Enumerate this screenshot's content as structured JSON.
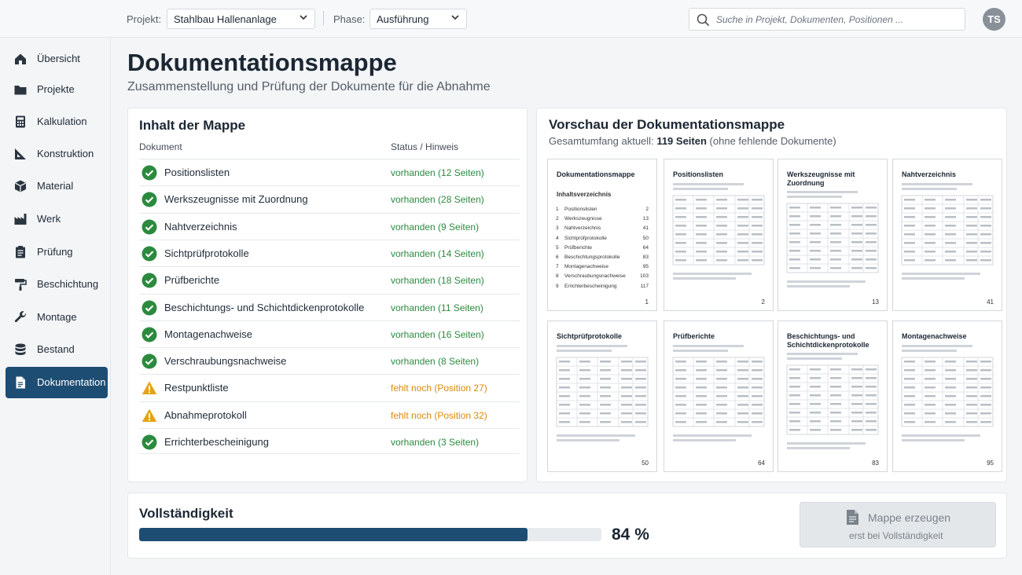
{
  "header": {
    "project_label": "Projekt:",
    "project_value": "Stahlbau Hallenanlage",
    "phase_label": "Phase:",
    "phase_value": "Ausführung",
    "search_placeholder": "Suche in Projekt, Dokumenten, Positionen ...",
    "avatar_initials": "TS"
  },
  "sidebar": {
    "items": [
      {
        "label": "Übersicht",
        "icon": "home-icon"
      },
      {
        "label": "Projekte",
        "icon": "folder-icon"
      },
      {
        "label": "Kalkulation",
        "icon": "calculator-icon"
      },
      {
        "label": "Konstruktion",
        "icon": "construction-icon"
      },
      {
        "label": "Material",
        "icon": "cube-icon"
      },
      {
        "label": "Werk",
        "icon": "factory-icon"
      },
      {
        "label": "Prüfung",
        "icon": "clipboard-icon"
      },
      {
        "label": "Beschichtung",
        "icon": "paint-roller-icon"
      },
      {
        "label": "Montage",
        "icon": "wrench-icon"
      },
      {
        "label": "Bestand",
        "icon": "database-icon"
      },
      {
        "label": "Dokumentation",
        "icon": "document-icon",
        "active": true
      }
    ]
  },
  "page": {
    "title": "Dokumentationsmappe",
    "subtitle": "Zusammenstellung und Prüfung der Dokumente für die Abnahme"
  },
  "contents": {
    "title": "Inhalt der Mappe",
    "col_document": "Dokument",
    "col_status": "Status / Hinweis",
    "rows": [
      {
        "name": "Positionslisten",
        "hint": "vorhanden (12 Seiten)",
        "status": "ok"
      },
      {
        "name": "Werkszeugnisse mit Zuordnung",
        "hint": "vorhanden (28 Seiten)",
        "status": "ok"
      },
      {
        "name": "Nahtverzeichnis",
        "hint": "vorhanden (9 Seiten)",
        "status": "ok"
      },
      {
        "name": "Sichtprüfprotokolle",
        "hint": "vorhanden (14 Seiten)",
        "status": "ok"
      },
      {
        "name": "Prüfberichte",
        "hint": "vorhanden (18 Seiten)",
        "status": "ok"
      },
      {
        "name": "Beschichtungs- und Schichtdickenprotokolle",
        "hint": "vorhanden (11 Seiten)",
        "status": "ok"
      },
      {
        "name": "Montagenachweise",
        "hint": "vorhanden (16 Seiten)",
        "status": "ok"
      },
      {
        "name": "Verschraubungsnachweise",
        "hint": "vorhanden (8 Seiten)",
        "status": "ok"
      },
      {
        "name": "Restpunktliste",
        "hint": "fehlt noch (Position 27)",
        "status": "warn"
      },
      {
        "name": "Abnahmeprotokoll",
        "hint": "fehlt noch (Position 32)",
        "status": "warn"
      },
      {
        "name": "Errichterbescheinigung",
        "hint": "vorhanden (3 Seiten)",
        "status": "ok"
      }
    ]
  },
  "preview": {
    "title": "Vorschau der Dokumentationsmappe",
    "sub_prefix": "Gesamtumfang aktuell:",
    "sub_bold": "119 Seiten",
    "sub_suffix": "(ohne fehlende Dokumente)",
    "toc_title": "Dokumentationsmappe",
    "toc_subtitle": "Inhaltsverzeichnis",
    "toc": [
      {
        "n": "1",
        "t": "Positionslisten",
        "p": "2"
      },
      {
        "n": "2",
        "t": "Werkszeugnisse",
        "p": "13"
      },
      {
        "n": "3",
        "t": "Nahtverzeichnis",
        "p": "41"
      },
      {
        "n": "4",
        "t": "Sichtprüfprotokolle",
        "p": "50"
      },
      {
        "n": "5",
        "t": "Prüfberichte",
        "p": "64"
      },
      {
        "n": "6",
        "t": "Beschichtungsprotokolle",
        "p": "83"
      },
      {
        "n": "7",
        "t": "Montagenachweise",
        "p": "95"
      },
      {
        "n": "8",
        "t": "Verschraubungsnachweise",
        "p": "103"
      },
      {
        "n": "9",
        "t": "Errichterbescheinigung",
        "p": "117"
      }
    ],
    "pages": [
      {
        "title": "Dokumentationsmappe",
        "num": "1"
      },
      {
        "title": "Positionslisten",
        "num": "2"
      },
      {
        "title": "Werkszeugnisse mit Zuordnung",
        "num": "13"
      },
      {
        "title": "Nahtverzeichnis",
        "num": "41"
      },
      {
        "title": "Sichtprüfprotokolle",
        "num": "50"
      },
      {
        "title": "Prüfberichte",
        "num": "64"
      },
      {
        "title": "Beschichtungs- und Schichtdickenprotokolle",
        "num": "83"
      },
      {
        "title": "Montagenachweise",
        "num": "95"
      }
    ]
  },
  "completeness": {
    "title": "Vollständigkeit",
    "percent": 84,
    "percent_label": "84 %"
  },
  "generate": {
    "label": "Mappe erzeugen",
    "sublabel": "erst bei Vollständigkeit"
  },
  "colors": {
    "accent": "#1e4d74",
    "ok": "#2c8a3f",
    "warn": "#d98a0c"
  }
}
